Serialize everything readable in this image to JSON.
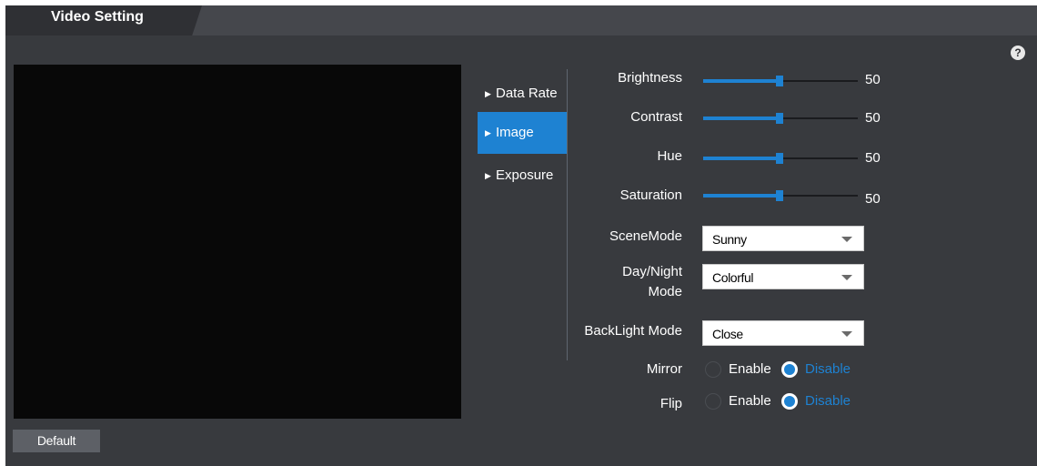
{
  "header": {
    "tab_title": "Video Setting"
  },
  "help_icon": "?",
  "footer": {
    "default_label": "Default"
  },
  "menu": {
    "items": [
      {
        "label": "Data Rate",
        "active": false
      },
      {
        "label": "Image",
        "active": true
      },
      {
        "label": "Exposure",
        "active": false
      }
    ],
    "arrow": "▶"
  },
  "image": {
    "brightness": {
      "label": "Brightness",
      "value": "50"
    },
    "contrast": {
      "label": "Contrast",
      "value": "50"
    },
    "hue": {
      "label": "Hue",
      "value": "50"
    },
    "saturation": {
      "label": "Saturation",
      "value": "50"
    },
    "scene_mode": {
      "label": "SceneMode",
      "selected": "Sunny"
    },
    "day_night": {
      "label_line1": "Day/Night",
      "label_line2": "Mode",
      "selected": "Colorful"
    },
    "backlight": {
      "label": "BackLight Mode",
      "selected": "Close"
    },
    "mirror": {
      "label": "Mirror",
      "enable": "Enable",
      "disable": "Disable",
      "selected": "Disable"
    },
    "flip": {
      "label": "Flip",
      "enable": "Enable",
      "disable": "Disable",
      "selected": "Disable"
    }
  },
  "colors": {
    "accent": "#1e82d2",
    "panel_bg": "#383a3e",
    "video_bg": "#080808"
  }
}
